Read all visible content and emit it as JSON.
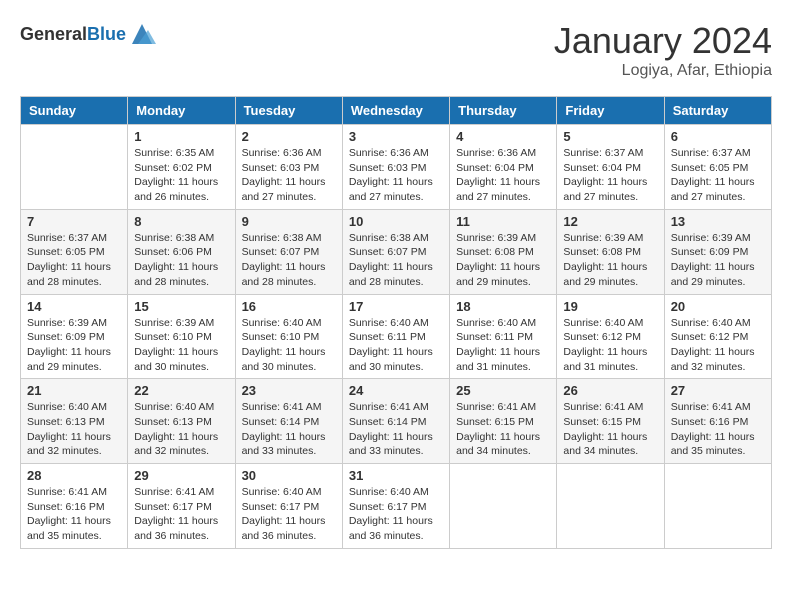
{
  "header": {
    "logo_general": "General",
    "logo_blue": "Blue",
    "month": "January 2024",
    "location": "Logiya, Afar, Ethiopia"
  },
  "days_of_week": [
    "Sunday",
    "Monday",
    "Tuesday",
    "Wednesday",
    "Thursday",
    "Friday",
    "Saturday"
  ],
  "weeks": [
    [
      {
        "num": "",
        "sunrise": "",
        "sunset": "",
        "daylight": ""
      },
      {
        "num": "1",
        "sunrise": "Sunrise: 6:35 AM",
        "sunset": "Sunset: 6:02 PM",
        "daylight": "Daylight: 11 hours and 26 minutes."
      },
      {
        "num": "2",
        "sunrise": "Sunrise: 6:36 AM",
        "sunset": "Sunset: 6:03 PM",
        "daylight": "Daylight: 11 hours and 27 minutes."
      },
      {
        "num": "3",
        "sunrise": "Sunrise: 6:36 AM",
        "sunset": "Sunset: 6:03 PM",
        "daylight": "Daylight: 11 hours and 27 minutes."
      },
      {
        "num": "4",
        "sunrise": "Sunrise: 6:36 AM",
        "sunset": "Sunset: 6:04 PM",
        "daylight": "Daylight: 11 hours and 27 minutes."
      },
      {
        "num": "5",
        "sunrise": "Sunrise: 6:37 AM",
        "sunset": "Sunset: 6:04 PM",
        "daylight": "Daylight: 11 hours and 27 minutes."
      },
      {
        "num": "6",
        "sunrise": "Sunrise: 6:37 AM",
        "sunset": "Sunset: 6:05 PM",
        "daylight": "Daylight: 11 hours and 27 minutes."
      }
    ],
    [
      {
        "num": "7",
        "sunrise": "Sunrise: 6:37 AM",
        "sunset": "Sunset: 6:05 PM",
        "daylight": "Daylight: 11 hours and 28 minutes."
      },
      {
        "num": "8",
        "sunrise": "Sunrise: 6:38 AM",
        "sunset": "Sunset: 6:06 PM",
        "daylight": "Daylight: 11 hours and 28 minutes."
      },
      {
        "num": "9",
        "sunrise": "Sunrise: 6:38 AM",
        "sunset": "Sunset: 6:07 PM",
        "daylight": "Daylight: 11 hours and 28 minutes."
      },
      {
        "num": "10",
        "sunrise": "Sunrise: 6:38 AM",
        "sunset": "Sunset: 6:07 PM",
        "daylight": "Daylight: 11 hours and 28 minutes."
      },
      {
        "num": "11",
        "sunrise": "Sunrise: 6:39 AM",
        "sunset": "Sunset: 6:08 PM",
        "daylight": "Daylight: 11 hours and 29 minutes."
      },
      {
        "num": "12",
        "sunrise": "Sunrise: 6:39 AM",
        "sunset": "Sunset: 6:08 PM",
        "daylight": "Daylight: 11 hours and 29 minutes."
      },
      {
        "num": "13",
        "sunrise": "Sunrise: 6:39 AM",
        "sunset": "Sunset: 6:09 PM",
        "daylight": "Daylight: 11 hours and 29 minutes."
      }
    ],
    [
      {
        "num": "14",
        "sunrise": "Sunrise: 6:39 AM",
        "sunset": "Sunset: 6:09 PM",
        "daylight": "Daylight: 11 hours and 29 minutes."
      },
      {
        "num": "15",
        "sunrise": "Sunrise: 6:39 AM",
        "sunset": "Sunset: 6:10 PM",
        "daylight": "Daylight: 11 hours and 30 minutes."
      },
      {
        "num": "16",
        "sunrise": "Sunrise: 6:40 AM",
        "sunset": "Sunset: 6:10 PM",
        "daylight": "Daylight: 11 hours and 30 minutes."
      },
      {
        "num": "17",
        "sunrise": "Sunrise: 6:40 AM",
        "sunset": "Sunset: 6:11 PM",
        "daylight": "Daylight: 11 hours and 30 minutes."
      },
      {
        "num": "18",
        "sunrise": "Sunrise: 6:40 AM",
        "sunset": "Sunset: 6:11 PM",
        "daylight": "Daylight: 11 hours and 31 minutes."
      },
      {
        "num": "19",
        "sunrise": "Sunrise: 6:40 AM",
        "sunset": "Sunset: 6:12 PM",
        "daylight": "Daylight: 11 hours and 31 minutes."
      },
      {
        "num": "20",
        "sunrise": "Sunrise: 6:40 AM",
        "sunset": "Sunset: 6:12 PM",
        "daylight": "Daylight: 11 hours and 32 minutes."
      }
    ],
    [
      {
        "num": "21",
        "sunrise": "Sunrise: 6:40 AM",
        "sunset": "Sunset: 6:13 PM",
        "daylight": "Daylight: 11 hours and 32 minutes."
      },
      {
        "num": "22",
        "sunrise": "Sunrise: 6:40 AM",
        "sunset": "Sunset: 6:13 PM",
        "daylight": "Daylight: 11 hours and 32 minutes."
      },
      {
        "num": "23",
        "sunrise": "Sunrise: 6:41 AM",
        "sunset": "Sunset: 6:14 PM",
        "daylight": "Daylight: 11 hours and 33 minutes."
      },
      {
        "num": "24",
        "sunrise": "Sunrise: 6:41 AM",
        "sunset": "Sunset: 6:14 PM",
        "daylight": "Daylight: 11 hours and 33 minutes."
      },
      {
        "num": "25",
        "sunrise": "Sunrise: 6:41 AM",
        "sunset": "Sunset: 6:15 PM",
        "daylight": "Daylight: 11 hours and 34 minutes."
      },
      {
        "num": "26",
        "sunrise": "Sunrise: 6:41 AM",
        "sunset": "Sunset: 6:15 PM",
        "daylight": "Daylight: 11 hours and 34 minutes."
      },
      {
        "num": "27",
        "sunrise": "Sunrise: 6:41 AM",
        "sunset": "Sunset: 6:16 PM",
        "daylight": "Daylight: 11 hours and 35 minutes."
      }
    ],
    [
      {
        "num": "28",
        "sunrise": "Sunrise: 6:41 AM",
        "sunset": "Sunset: 6:16 PM",
        "daylight": "Daylight: 11 hours and 35 minutes."
      },
      {
        "num": "29",
        "sunrise": "Sunrise: 6:41 AM",
        "sunset": "Sunset: 6:17 PM",
        "daylight": "Daylight: 11 hours and 36 minutes."
      },
      {
        "num": "30",
        "sunrise": "Sunrise: 6:40 AM",
        "sunset": "Sunset: 6:17 PM",
        "daylight": "Daylight: 11 hours and 36 minutes."
      },
      {
        "num": "31",
        "sunrise": "Sunrise: 6:40 AM",
        "sunset": "Sunset: 6:17 PM",
        "daylight": "Daylight: 11 hours and 36 minutes."
      },
      {
        "num": "",
        "sunrise": "",
        "sunset": "",
        "daylight": ""
      },
      {
        "num": "",
        "sunrise": "",
        "sunset": "",
        "daylight": ""
      },
      {
        "num": "",
        "sunrise": "",
        "sunset": "",
        "daylight": ""
      }
    ]
  ]
}
